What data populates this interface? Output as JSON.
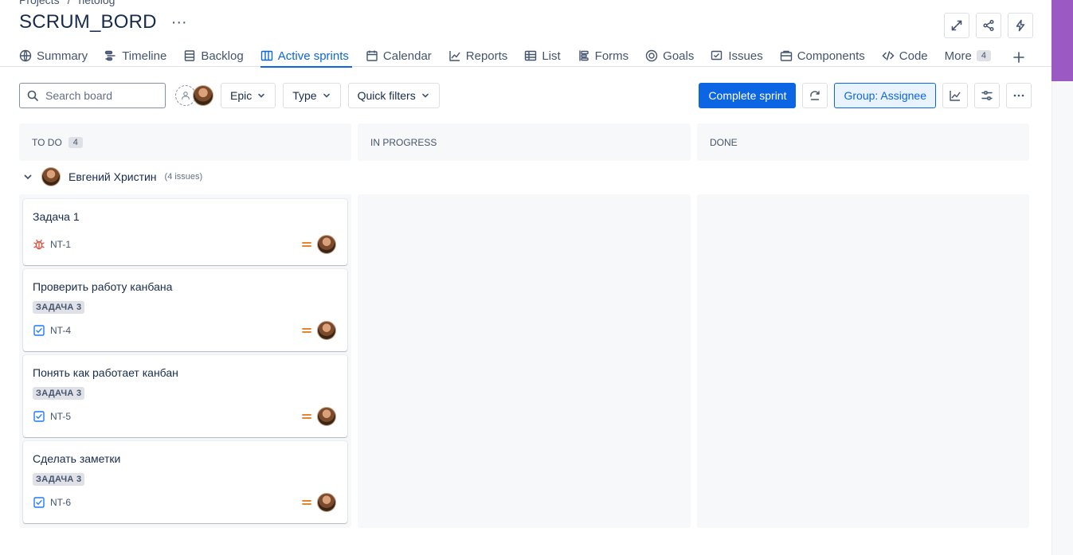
{
  "breadcrumb": {
    "projects": "Projects",
    "separator": "/",
    "project": "netolog"
  },
  "page": {
    "title": "SCRUM_BORD",
    "more": "···"
  },
  "tabs": [
    {
      "label": "Summary",
      "icon": "globe-icon"
    },
    {
      "label": "Timeline",
      "icon": "timeline-icon"
    },
    {
      "label": "Backlog",
      "icon": "backlog-icon"
    },
    {
      "label": "Active sprints",
      "icon": "board-icon"
    },
    {
      "label": "Calendar",
      "icon": "calendar-icon"
    },
    {
      "label": "Reports",
      "icon": "chart-line-icon"
    },
    {
      "label": "List",
      "icon": "list-icon"
    },
    {
      "label": "Forms",
      "icon": "forms-icon"
    },
    {
      "label": "Goals",
      "icon": "goals-icon"
    },
    {
      "label": "Issues",
      "icon": "issues-icon"
    },
    {
      "label": "Components",
      "icon": "components-icon"
    },
    {
      "label": "Code",
      "icon": "code-icon"
    },
    {
      "label": "More",
      "icon": "",
      "count": "4"
    }
  ],
  "toolbar": {
    "search_placeholder": "Search board",
    "epic": "Epic",
    "type": "Type",
    "quick_filters": "Quick filters",
    "complete_sprint": "Complete sprint",
    "group": "Group: Assignee"
  },
  "columns": [
    {
      "name": "TO DO",
      "count": "4"
    },
    {
      "name": "IN PROGRESS"
    },
    {
      "name": "DONE"
    }
  ],
  "swimlane": {
    "assignee": "Евгений Христин",
    "count": "(4 issues)"
  },
  "cards": [
    {
      "title": "Задача 1",
      "epic": "",
      "key": "NT-1",
      "type": "bug"
    },
    {
      "title": "Проверить работу канбана",
      "epic": "ЗАДАЧА 3",
      "key": "NT-4",
      "type": "task"
    },
    {
      "title": "Понять как работает канбан",
      "epic": "ЗАДАЧА 3",
      "key": "NT-5",
      "type": "task"
    },
    {
      "title": "Сделать заметки",
      "epic": "ЗАДАЧА 3",
      "key": "NT-6",
      "type": "task"
    }
  ],
  "colors": {
    "accent": "#0c66e4",
    "priority": "#e2740b",
    "bug": "#e34935",
    "purple": "#9b59c4"
  }
}
